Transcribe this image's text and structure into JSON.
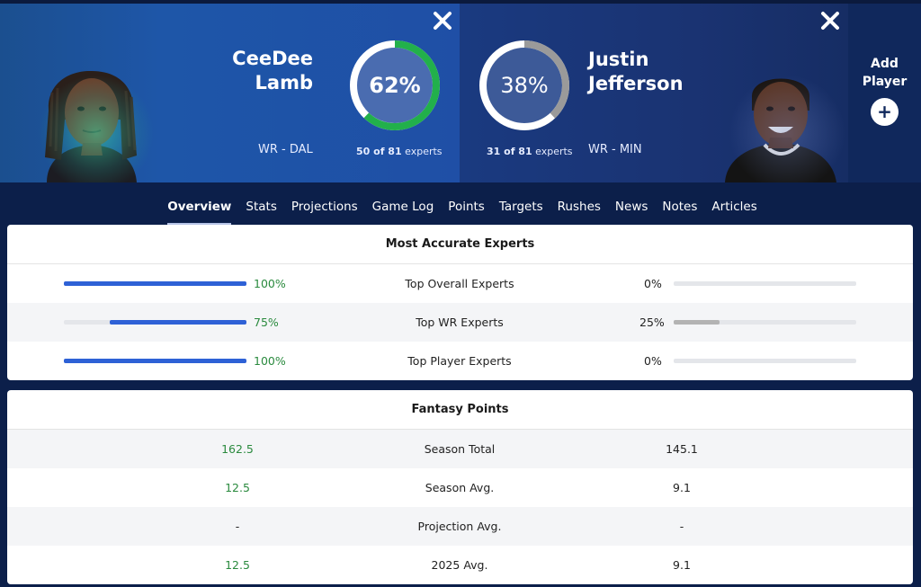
{
  "players": {
    "left": {
      "name_line1": "CeeDee",
      "name_line2": "Lamb",
      "position": "WR - DAL",
      "percent": "62%",
      "percent_value": 0.62,
      "experts_count": "50 of 81",
      "experts_suffix": "experts",
      "ring_color": "#22b04b"
    },
    "right": {
      "name_line1": "Justin",
      "name_line2": "Jefferson",
      "position": "WR - MIN",
      "percent": "38%",
      "percent_value": 0.38,
      "experts_count": "31 of 81",
      "experts_suffix": "experts",
      "ring_color": "#9a9a9a"
    }
  },
  "add_player": {
    "line1": "Add",
    "line2": "Player",
    "icon": "plus-icon"
  },
  "tabs": [
    {
      "label": "Overview",
      "active": true
    },
    {
      "label": "Stats"
    },
    {
      "label": "Projections"
    },
    {
      "label": "Game Log"
    },
    {
      "label": "Points"
    },
    {
      "label": "Targets"
    },
    {
      "label": "Rushes"
    },
    {
      "label": "News"
    },
    {
      "label": "Notes"
    },
    {
      "label": "Articles"
    }
  ],
  "accurate_experts": {
    "title": "Most Accurate Experts",
    "rows": [
      {
        "label": "Top Overall Experts",
        "left": "100%",
        "left_value": 1.0,
        "right": "0%",
        "right_value": 0.0
      },
      {
        "label": "Top WR Experts",
        "left": "75%",
        "left_value": 0.75,
        "right": "25%",
        "right_value": 0.25
      },
      {
        "label": "Top Player Experts",
        "left": "100%",
        "left_value": 1.0,
        "right": "0%",
        "right_value": 0.0
      }
    ]
  },
  "fantasy_points": {
    "title": "Fantasy Points",
    "rows": [
      {
        "label": "Season Total",
        "left": "162.5",
        "right": "145.1"
      },
      {
        "label": "Season Avg.",
        "left": "12.5",
        "right": "9.1"
      },
      {
        "label": "Projection Avg.",
        "left": "-",
        "right": "-"
      },
      {
        "label": "2025 Avg.",
        "left": "12.5",
        "right": "9.1"
      }
    ]
  },
  "colors": {
    "bar_left": "#2e61d6",
    "bar_right": "#b3b3b3",
    "positive_text": "#2a8a3e"
  }
}
